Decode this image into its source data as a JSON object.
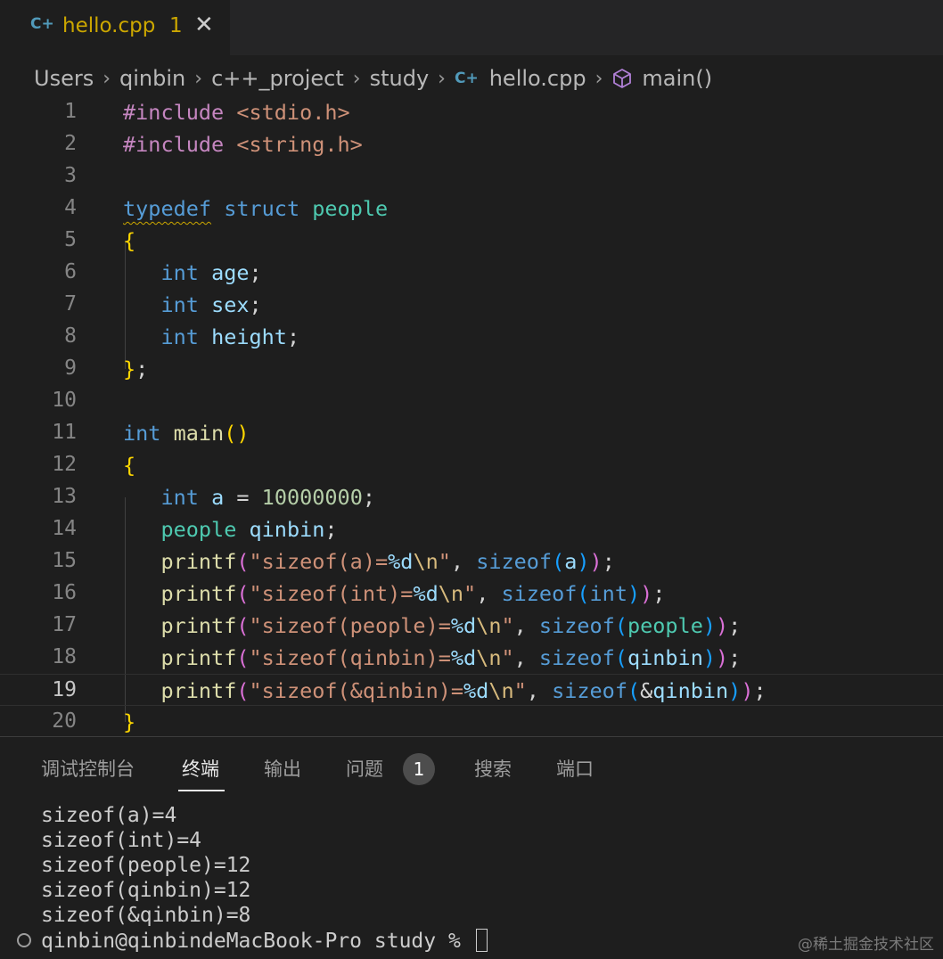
{
  "tab": {
    "file_icon": "C+",
    "title": "hello.cpp",
    "problem_count": "1",
    "close_glyph": "✕"
  },
  "breadcrumb": {
    "items": [
      "Users",
      "qinbin",
      "c++_project",
      "study"
    ],
    "file_icon": "C+",
    "file": "hello.cpp",
    "symbol": "main()",
    "symbol_icon": "symbol-method-cube-icon"
  },
  "editor": {
    "line_numbers": [
      "1",
      "2",
      "3",
      "4",
      "5",
      "6",
      "7",
      "8",
      "9",
      "10",
      "11",
      "12",
      "13",
      "14",
      "15",
      "16",
      "17",
      "18",
      "19",
      "20"
    ],
    "current_line": 19,
    "lines": [
      "#include <stdio.h>",
      "#include <string.h>",
      "",
      "typedef struct people",
      "{",
      "    int age;",
      "    int sex;",
      "    int height;",
      "};",
      "",
      "int main()",
      "{",
      "    int a = 10000000;",
      "    people qinbin;",
      "    printf(\"sizeof(a)=%d\\n\", sizeof(a));",
      "    printf(\"sizeof(int)=%d\\n\", sizeof(int));",
      "    printf(\"sizeof(people)=%d\\n\", sizeof(people));",
      "    printf(\"sizeof(qinbin)=%d\\n\", sizeof(qinbin));",
      "    printf(\"sizeof(&qinbin)=%d\\n\", sizeof(&qinbin));",
      "}"
    ],
    "colors": {
      "preprocessor": "#c586c0",
      "string": "#ce9178",
      "keyword": "#569cd6",
      "type": "#4ec9b0",
      "function": "#dcdcaa",
      "variable": "#9cdcfe",
      "number": "#b5cea8",
      "escape": "#d7ba7d",
      "bracket_1": "#ffd700",
      "bracket_2": "#da70d6",
      "bracket_3": "#179fff",
      "warning_squiggle": "#cca700"
    }
  },
  "panel": {
    "tabs": [
      "调试控制台",
      "终端",
      "输出",
      "问题",
      "搜索",
      "端口"
    ],
    "active_tab": "终端",
    "problems_badge": "1",
    "terminal_output": [
      "sizeof(a)=4",
      "sizeof(int)=4",
      "sizeof(people)=12",
      "sizeof(qinbin)=12",
      "sizeof(&qinbin)=8"
    ],
    "prompt": "qinbin@qinbindeMacBook-Pro study % "
  },
  "watermark": "@稀土掘金技术社区"
}
